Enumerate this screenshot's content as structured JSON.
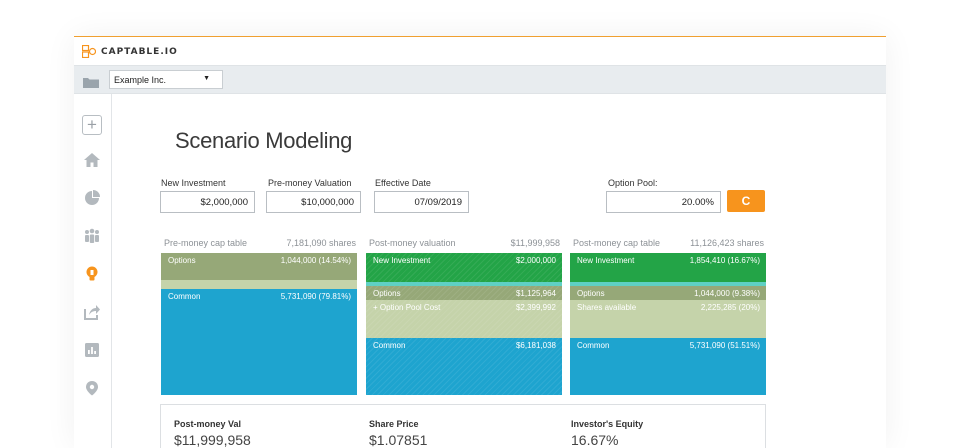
{
  "brand": {
    "name": "CAPTABLE.IO"
  },
  "toolbar": {
    "company": "Example Inc.",
    "company_arrow": "▼"
  },
  "nav": {
    "add_symbol": "+",
    "icons": [
      "home-icon",
      "pie-chart-icon",
      "people-icon",
      "lightbulb-icon",
      "share-icon",
      "bar-chart-icon",
      "map-pin-icon"
    ],
    "active": "lightbulb-icon"
  },
  "page": {
    "title": "Scenario Modeling"
  },
  "form": {
    "new_investment": {
      "label": "New Investment",
      "value": "$2,000,000"
    },
    "pre_money": {
      "label": "Pre-money Valuation",
      "value": "$10,000,000"
    },
    "effective_date": {
      "label": "Effective Date",
      "value": "07/09/2019"
    },
    "option_pool": {
      "label": "Option Pool:",
      "value": "20.00%"
    },
    "reset_symbol": "C"
  },
  "columns": [
    {
      "header": "Pre-money cap table",
      "header_value": "7,181,090 shares",
      "segments": [
        {
          "label": "Options",
          "value": "1,044,000 (14.54%)"
        },
        {
          "label": "",
          "value": ""
        },
        {
          "label": "Common",
          "value": "5,731,090 (79.81%)"
        }
      ]
    },
    {
      "header": "Post-money valuation",
      "header_value": "$11,999,958",
      "segments": [
        {
          "label": "New Investment",
          "value": "$2,000,000"
        },
        {
          "label": "Options",
          "value": "$1,125,964"
        },
        {
          "label": "+ Option Pool Cost",
          "value": "$2,399,992"
        },
        {
          "label": "Common",
          "value": "$6,181,038"
        }
      ]
    },
    {
      "header": "Post-money cap table",
      "header_value": "11,126,423 shares",
      "segments": [
        {
          "label": "New Investment",
          "value": "1,854,410 (16.67%)"
        },
        {
          "label": "Options",
          "value": "1,044,000 (9.38%)"
        },
        {
          "label": "Shares available",
          "value": "2,225,285 (20%)"
        },
        {
          "label": "Common",
          "value": "5,731,090 (51.51%)"
        }
      ]
    }
  ],
  "summary": {
    "post_money": {
      "label": "Post-money Val",
      "value": "$11,999,958"
    },
    "share_price": {
      "label": "Share Price",
      "value": "$1.07851"
    },
    "equity": {
      "label": "Investor's Equity",
      "value": "16.67%"
    }
  },
  "colors": {
    "accent": "#f7941d",
    "options": "#96a878",
    "shares_available": "#c5d3aa",
    "common": "#1ea4cf",
    "new_investment": "#23a447",
    "teal_divider": "#5fd0c4"
  }
}
